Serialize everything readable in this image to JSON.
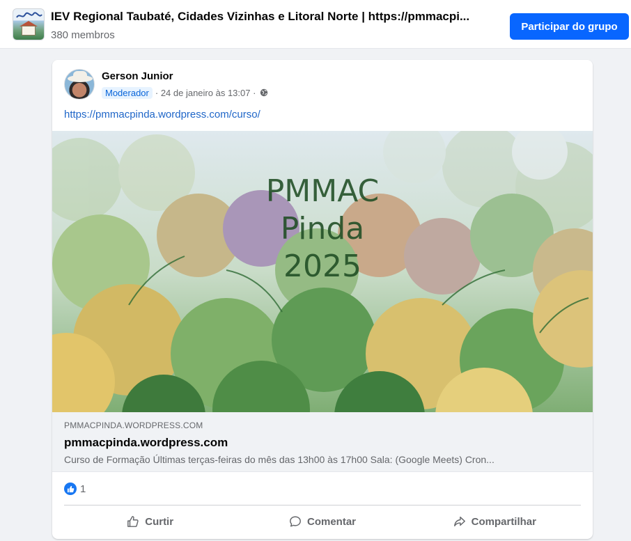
{
  "group": {
    "title": "IEV Regional Taubaté, Cidades Vizinhas e Litoral Norte | https://pmmacpi...",
    "members": "380 membros",
    "join_label": "Participar do grupo",
    "avatar_icon": "group-cover-avatar"
  },
  "post": {
    "author": "Gerson Junior",
    "role": "Moderador",
    "date": "· 24 de janeiro às 13:07 ·",
    "privacy_icon": "globe-icon",
    "link_text": "https://pmmacpinda.wordpress.com/curso/",
    "preview": {
      "lines": [
        "PMMAC",
        "Pinda",
        "2025"
      ]
    },
    "link_preview": {
      "domain": "PMMACPINDA.WORDPRESS.COM",
      "title": "pmmacpinda.wordpress.com",
      "description": "Curso de Formação Últimas terças-feiras do mês das 13h00 às 17h00 Sala: (Google Meets) Cron..."
    },
    "reactions": {
      "icon": "like-icon",
      "count": "1"
    },
    "actions": {
      "like": "Curtir",
      "comment": "Comentar",
      "share": "Compartilhar"
    }
  },
  "colors": {
    "primary_button": "#0866ff",
    "link": "#1f66c8",
    "badge_bg": "#e7f3ff",
    "badge_text": "#0864d9",
    "like_blue": "#1877f2"
  }
}
